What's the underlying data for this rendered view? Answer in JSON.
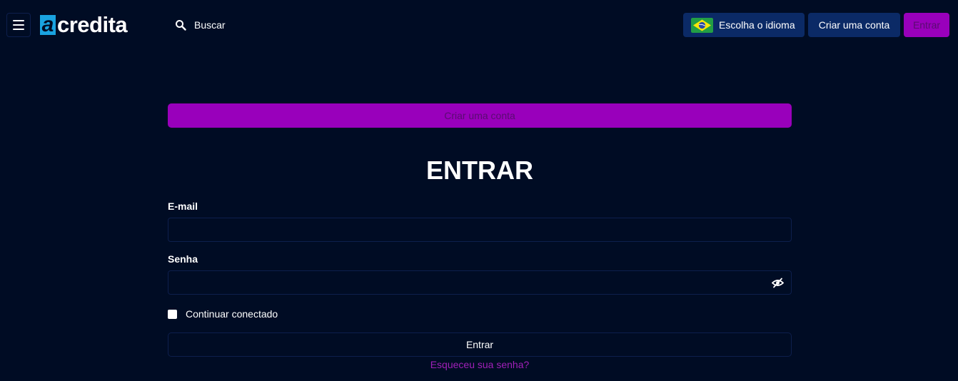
{
  "header": {
    "logo_letter": "a",
    "logo_text": "credita",
    "search_label": "Buscar",
    "language_label": "Escolha o idioma",
    "create_account_label": "Criar uma conta",
    "login_label": "Entrar"
  },
  "icons": {
    "menu": "hamburger-icon",
    "search": "search-icon",
    "flag": "brazil-flag-icon",
    "password_toggle": "eye-slash-icon"
  },
  "colors": {
    "background": "#000c24",
    "accent": "#9900bb",
    "secondary_button": "#0b2a66",
    "link": "#a020b8"
  },
  "login_form": {
    "create_account_label": "Criar uma conta",
    "title": "ENTRAR",
    "email_label": "E-mail",
    "email_value": "",
    "password_label": "Senha",
    "password_value": "",
    "remember_label": "Continuar conectado",
    "submit_label": "Entrar",
    "forgot_label": "Esqueceu sua senha?"
  }
}
